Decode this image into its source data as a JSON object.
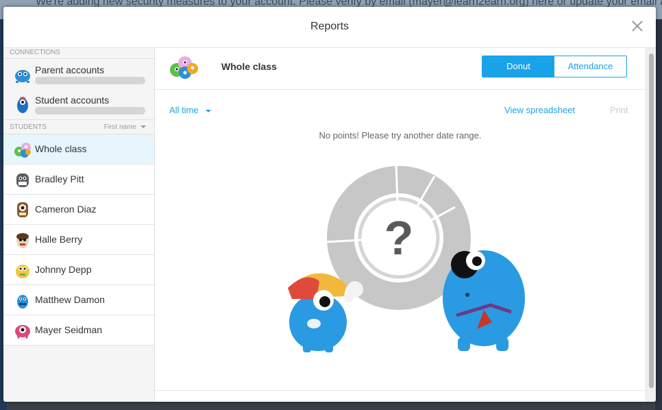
{
  "backdrop": {
    "banner_text": "We're adding new security measures to your account. Please verify by email (mayer@learn2earn.org) here or update your email address!"
  },
  "modal": {
    "title": "Reports"
  },
  "sidebar": {
    "connections_header": "CONNECTIONS",
    "connections": [
      {
        "label": "Parent accounts"
      },
      {
        "label": "Student accounts"
      }
    ],
    "students_header": "STUDENTS",
    "sort_label": "First name",
    "students": [
      {
        "name": "Whole class",
        "color": "#e9aee0"
      },
      {
        "name": "Bradley Pitt",
        "color": "#5a5d63"
      },
      {
        "name": "Cameron Diaz",
        "color": "#8b5a2b"
      },
      {
        "name": "Halle Berry",
        "color": "#e8d6b8"
      },
      {
        "name": "Johnny Depp",
        "color": "#f4c542"
      },
      {
        "name": "Matthew Damon",
        "color": "#2a8fd8"
      },
      {
        "name": "Mayer Seidman",
        "color": "#e0457b"
      }
    ]
  },
  "content": {
    "class_title": "Whole class",
    "tabs": [
      "Donut",
      "Attendance"
    ],
    "date_filter": "All time",
    "view_spreadsheet": "View spreadsheet",
    "print": "Print",
    "empty_message": "No points! Please try another date range.",
    "placeholder_symbol": "?"
  },
  "colors": {
    "accent": "#1aa3e8",
    "active_row": "#e7f6fc",
    "donut_gray": "#c7c7c7"
  }
}
